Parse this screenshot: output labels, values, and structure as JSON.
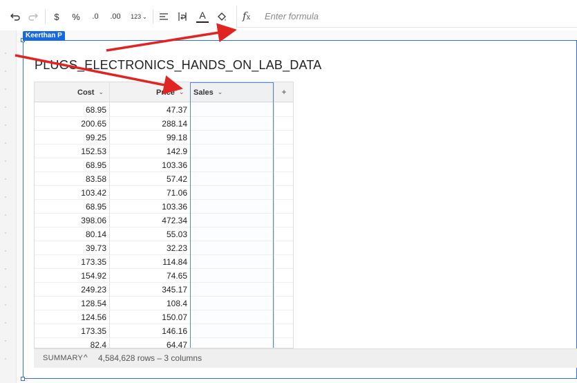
{
  "toolbar": {
    "undo_icon": "undo-icon",
    "redo_icon": "redo-icon",
    "currency_label": "$",
    "percent_label": "%",
    "decrease_decimals_label": ".0",
    "increase_decimals_label": ".00",
    "number_format_label": "123",
    "formula_placeholder": "Enter formula",
    "formula_value": ""
  },
  "element": {
    "user_tag": "Keerthan P",
    "title": "PLUGS_ELECTRONICS_HANDS_ON_LAB_DATA"
  },
  "table": {
    "columns": [
      {
        "label": "Cost"
      },
      {
        "label": "Price"
      },
      {
        "label": "Sales"
      }
    ],
    "add_column_label": "+",
    "rows": [
      {
        "cost": "68.95",
        "price": "47.37"
      },
      {
        "cost": "200.65",
        "price": "288.14"
      },
      {
        "cost": "99.25",
        "price": "99.18"
      },
      {
        "cost": "152.53",
        "price": "142.9"
      },
      {
        "cost": "68.95",
        "price": "103.36"
      },
      {
        "cost": "83.58",
        "price": "57.42"
      },
      {
        "cost": "103.42",
        "price": "71.06"
      },
      {
        "cost": "68.95",
        "price": "103.36"
      },
      {
        "cost": "398.06",
        "price": "472.34"
      },
      {
        "cost": "80.14",
        "price": "55.03"
      },
      {
        "cost": "39.73",
        "price": "32.23"
      },
      {
        "cost": "173.35",
        "price": "114.84"
      },
      {
        "cost": "154.92",
        "price": "74.65"
      },
      {
        "cost": "249.23",
        "price": "345.17"
      },
      {
        "cost": "128.54",
        "price": "108.4"
      },
      {
        "cost": "124.56",
        "price": "150.07"
      },
      {
        "cost": "173.35",
        "price": "146.16"
      },
      {
        "cost": "82.4",
        "price": "64.47"
      }
    ]
  },
  "summary": {
    "label": "SUMMARY",
    "caret": "^",
    "info": "4,584,628 rows – 3 columns"
  },
  "colors": {
    "selection_blue": "#2f6fdc",
    "annotation_red": "#e02424"
  }
}
